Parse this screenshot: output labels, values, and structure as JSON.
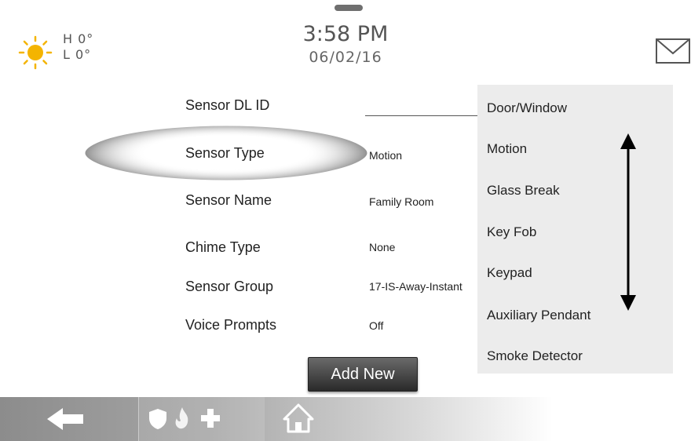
{
  "app": {
    "brand_colors": {
      "bar": "#9a9a9a",
      "dropdown_bg": "#ececec",
      "sun": "#f4b400",
      "button": "#3a3a3a"
    }
  },
  "header": {
    "weather": {
      "icon": "sun-icon",
      "hi": "H 0°",
      "lo": "L 0°"
    },
    "time": "3:58 PM",
    "date": "06/02/16",
    "mail_icon": "envelope-icon"
  },
  "form": {
    "fields": [
      {
        "label": "Sensor DL ID",
        "value": ""
      },
      {
        "label": "Sensor Type",
        "value": "Motion"
      },
      {
        "label": "Sensor Name",
        "value": "Family Room"
      },
      {
        "label": "Chime Type",
        "value": "None"
      },
      {
        "label": "Sensor Group",
        "value": "17-IS-Away-Instant"
      },
      {
        "label": "Voice Prompts",
        "value": "Off"
      }
    ],
    "add_new_label": "Add New"
  },
  "dropdown": {
    "options": [
      "Door/Window",
      "Motion",
      "Glass Break",
      "Key Fob",
      "Keypad",
      "Auxiliary Pendant",
      "Smoke Detector"
    ],
    "scroll_icon": "double-arrow-icon"
  },
  "bottom_bar": {
    "buttons": [
      {
        "icon": "back-arrow-icon"
      },
      {
        "icons": [
          "shield-icon",
          "fire-icon",
          "plus-icon"
        ]
      },
      {
        "icon": "home-icon"
      }
    ]
  }
}
